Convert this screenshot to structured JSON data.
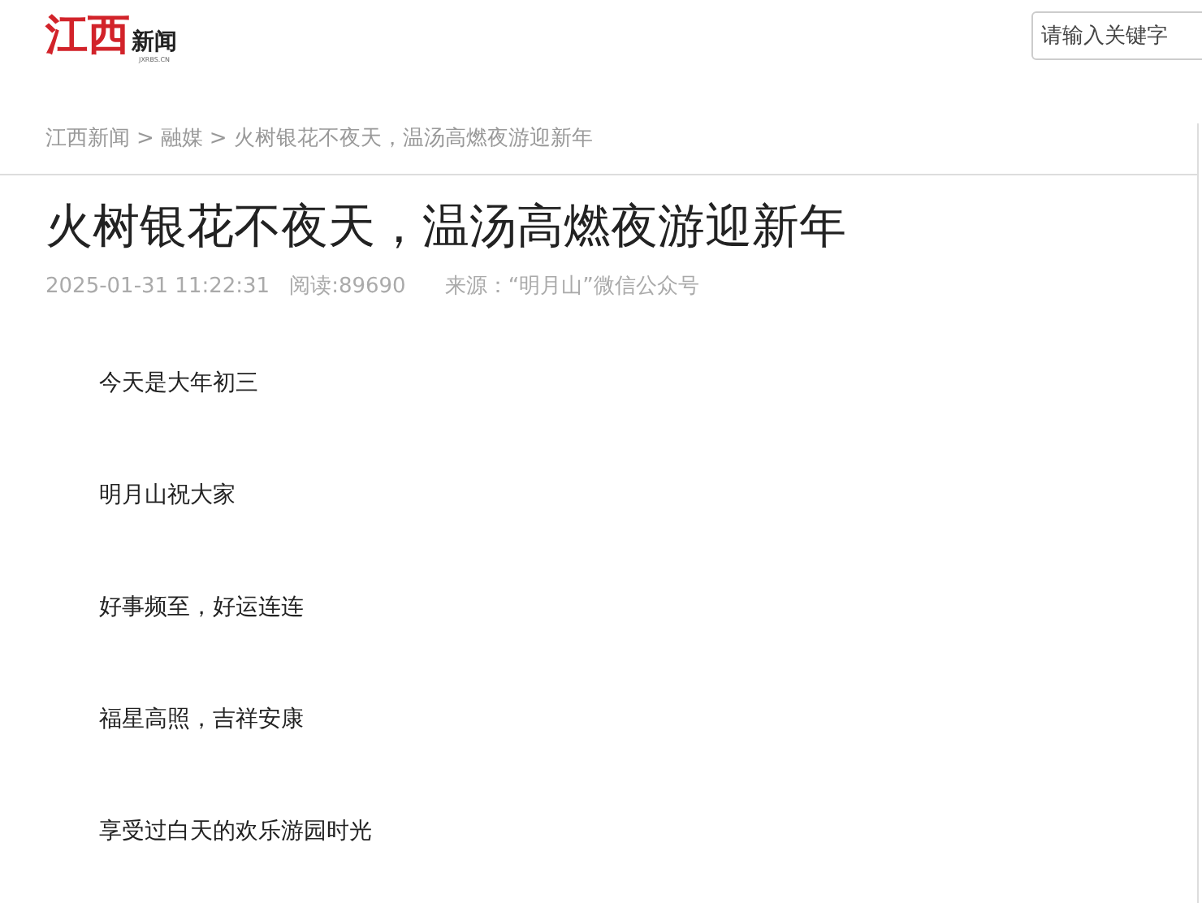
{
  "header": {
    "logo": {
      "main": "江西",
      "suffix": "新闻",
      "domain": "JXRBS.CN"
    },
    "search": {
      "placeholder": "请输入关键字"
    }
  },
  "breadcrumb": [
    {
      "label": "江西新闻"
    },
    {
      "label": "融媒",
      "separator": ">"
    },
    {
      "label": "火树银花不夜天，温汤高燃夜游迎新年",
      "separator": ">"
    }
  ],
  "article": {
    "title": "火树银花不夜天，温汤高燃夜游迎新年",
    "datetime": "2025-01-31 11:22:31",
    "reads": "阅读:89690",
    "source": "来源：“明月山”微信公众号",
    "paragraphs": [
      "今天是大年初三",
      "明月山祝大家",
      "好事频至，好运连连",
      "福星高照，吉祥安康",
      "享受过白天的欢乐游园时光"
    ]
  }
}
